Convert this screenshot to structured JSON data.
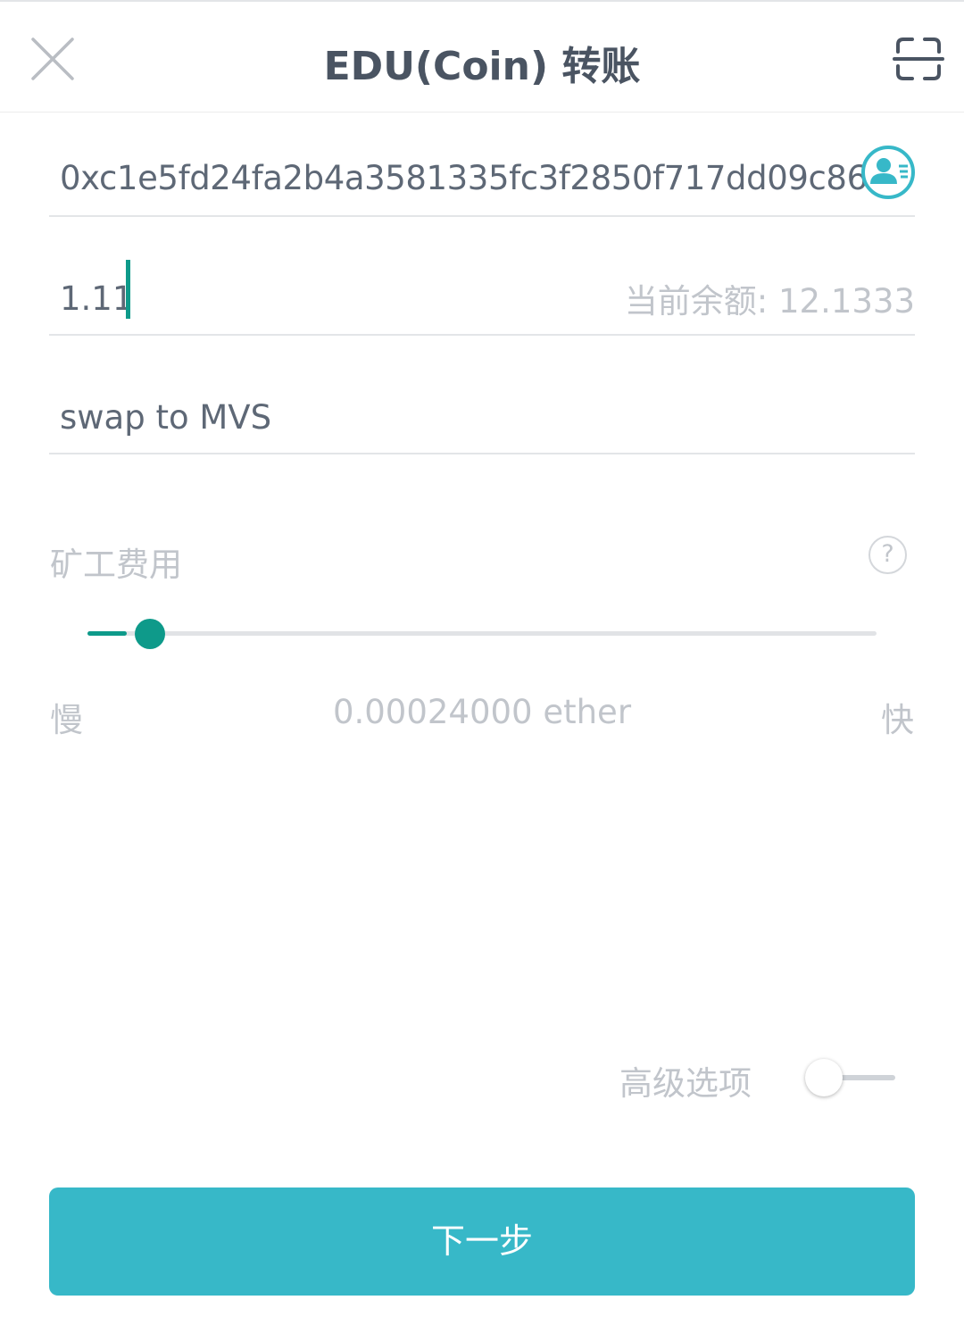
{
  "header": {
    "title": "EDU(Coin) 转账",
    "close_icon": "close-icon",
    "scan_icon": "scan-icon"
  },
  "form": {
    "address": {
      "value": "0xc1e5fd24fa2b4a3581335fc3f2850f717dd09c86",
      "contact_icon": "contact-book-icon"
    },
    "amount": {
      "value": "1.11",
      "balance_text": "当前余额: 12.1333"
    },
    "memo": {
      "value": "swap to MVS"
    }
  },
  "fee": {
    "label": "矿工费用",
    "help_icon_text": "?",
    "slider_level": 0.05,
    "slow_label": "慢",
    "fast_label": "快",
    "value_text": "0.00024000 ether"
  },
  "advanced": {
    "label": "高级选项",
    "enabled": false
  },
  "next_button": {
    "label": "下一步"
  },
  "colors": {
    "accent": "#0e9a8a",
    "button": "#37b8c8",
    "title_text": "#4a5462",
    "muted_text": "#c1c5cb"
  }
}
